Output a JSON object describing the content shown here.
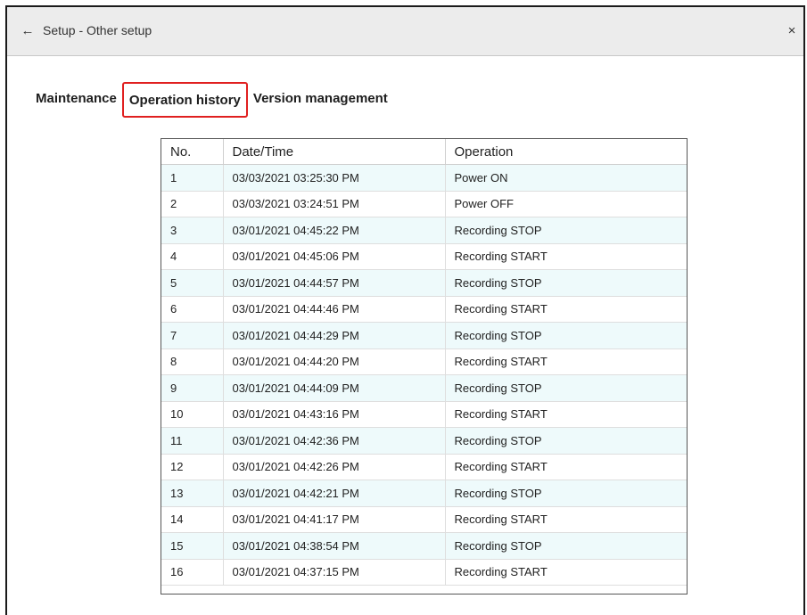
{
  "window": {
    "title": "Setup - Other setup",
    "back_icon": "←",
    "close_icon": "×"
  },
  "tabs": [
    {
      "label": "Maintenance",
      "active": false
    },
    {
      "label": "Operation history",
      "active": true
    },
    {
      "label": "Version management",
      "active": false
    }
  ],
  "colors": {
    "active_tab_border": "#e02020",
    "row_alt": "#eefafb"
  },
  "table": {
    "headers": [
      "No.",
      "Date/Time",
      "Operation"
    ],
    "rows": [
      [
        "1",
        "03/03/2021 03:25:30 PM",
        "Power ON"
      ],
      [
        "2",
        "03/03/2021 03:24:51 PM",
        "Power OFF"
      ],
      [
        "3",
        "03/01/2021 04:45:22 PM",
        "Recording STOP"
      ],
      [
        "4",
        "03/01/2021 04:45:06 PM",
        "Recording START"
      ],
      [
        "5",
        "03/01/2021 04:44:57 PM",
        "Recording STOP"
      ],
      [
        "6",
        "03/01/2021 04:44:46 PM",
        "Recording START"
      ],
      [
        "7",
        "03/01/2021 04:44:29 PM",
        "Recording STOP"
      ],
      [
        "8",
        "03/01/2021 04:44:20 PM",
        "Recording START"
      ],
      [
        "9",
        "03/01/2021 04:44:09 PM",
        "Recording STOP"
      ],
      [
        "10",
        "03/01/2021 04:43:16 PM",
        "Recording START"
      ],
      [
        "11",
        "03/01/2021 04:42:36 PM",
        "Recording STOP"
      ],
      [
        "12",
        "03/01/2021 04:42:26 PM",
        "Recording START"
      ],
      [
        "13",
        "03/01/2021 04:42:21 PM",
        "Recording STOP"
      ],
      [
        "14",
        "03/01/2021 04:41:17 PM",
        "Recording START"
      ],
      [
        "15",
        "03/01/2021 04:38:54 PM",
        "Recording STOP"
      ],
      [
        "16",
        "03/01/2021 04:37:15 PM",
        "Recording START"
      ]
    ]
  }
}
